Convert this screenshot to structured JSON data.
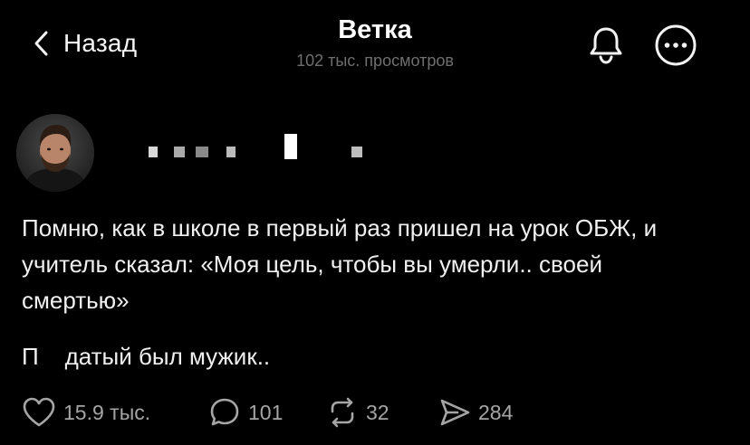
{
  "colors": {
    "background": "#000000",
    "text": "#f0f0f0",
    "muted": "#6f6f6f",
    "counter": "#a5a5a5"
  },
  "header": {
    "back_label": "Назад",
    "title": "Ветка",
    "subtitle": "102 тыс. просмотров",
    "icons": [
      "chevron-left-icon",
      "bell-icon",
      "more-icon"
    ]
  },
  "post": {
    "paragraphs": [
      "Помню, как в школе в первый раз пришел на урок ОБЖ, и учитель сказал: «Моя цель, чтобы вы умерли.. своей смертью»",
      "П    датый был мужик.."
    ]
  },
  "actions": {
    "likes": "15.9 тыс.",
    "comments": "101",
    "reposts": "32",
    "shares": "284"
  }
}
